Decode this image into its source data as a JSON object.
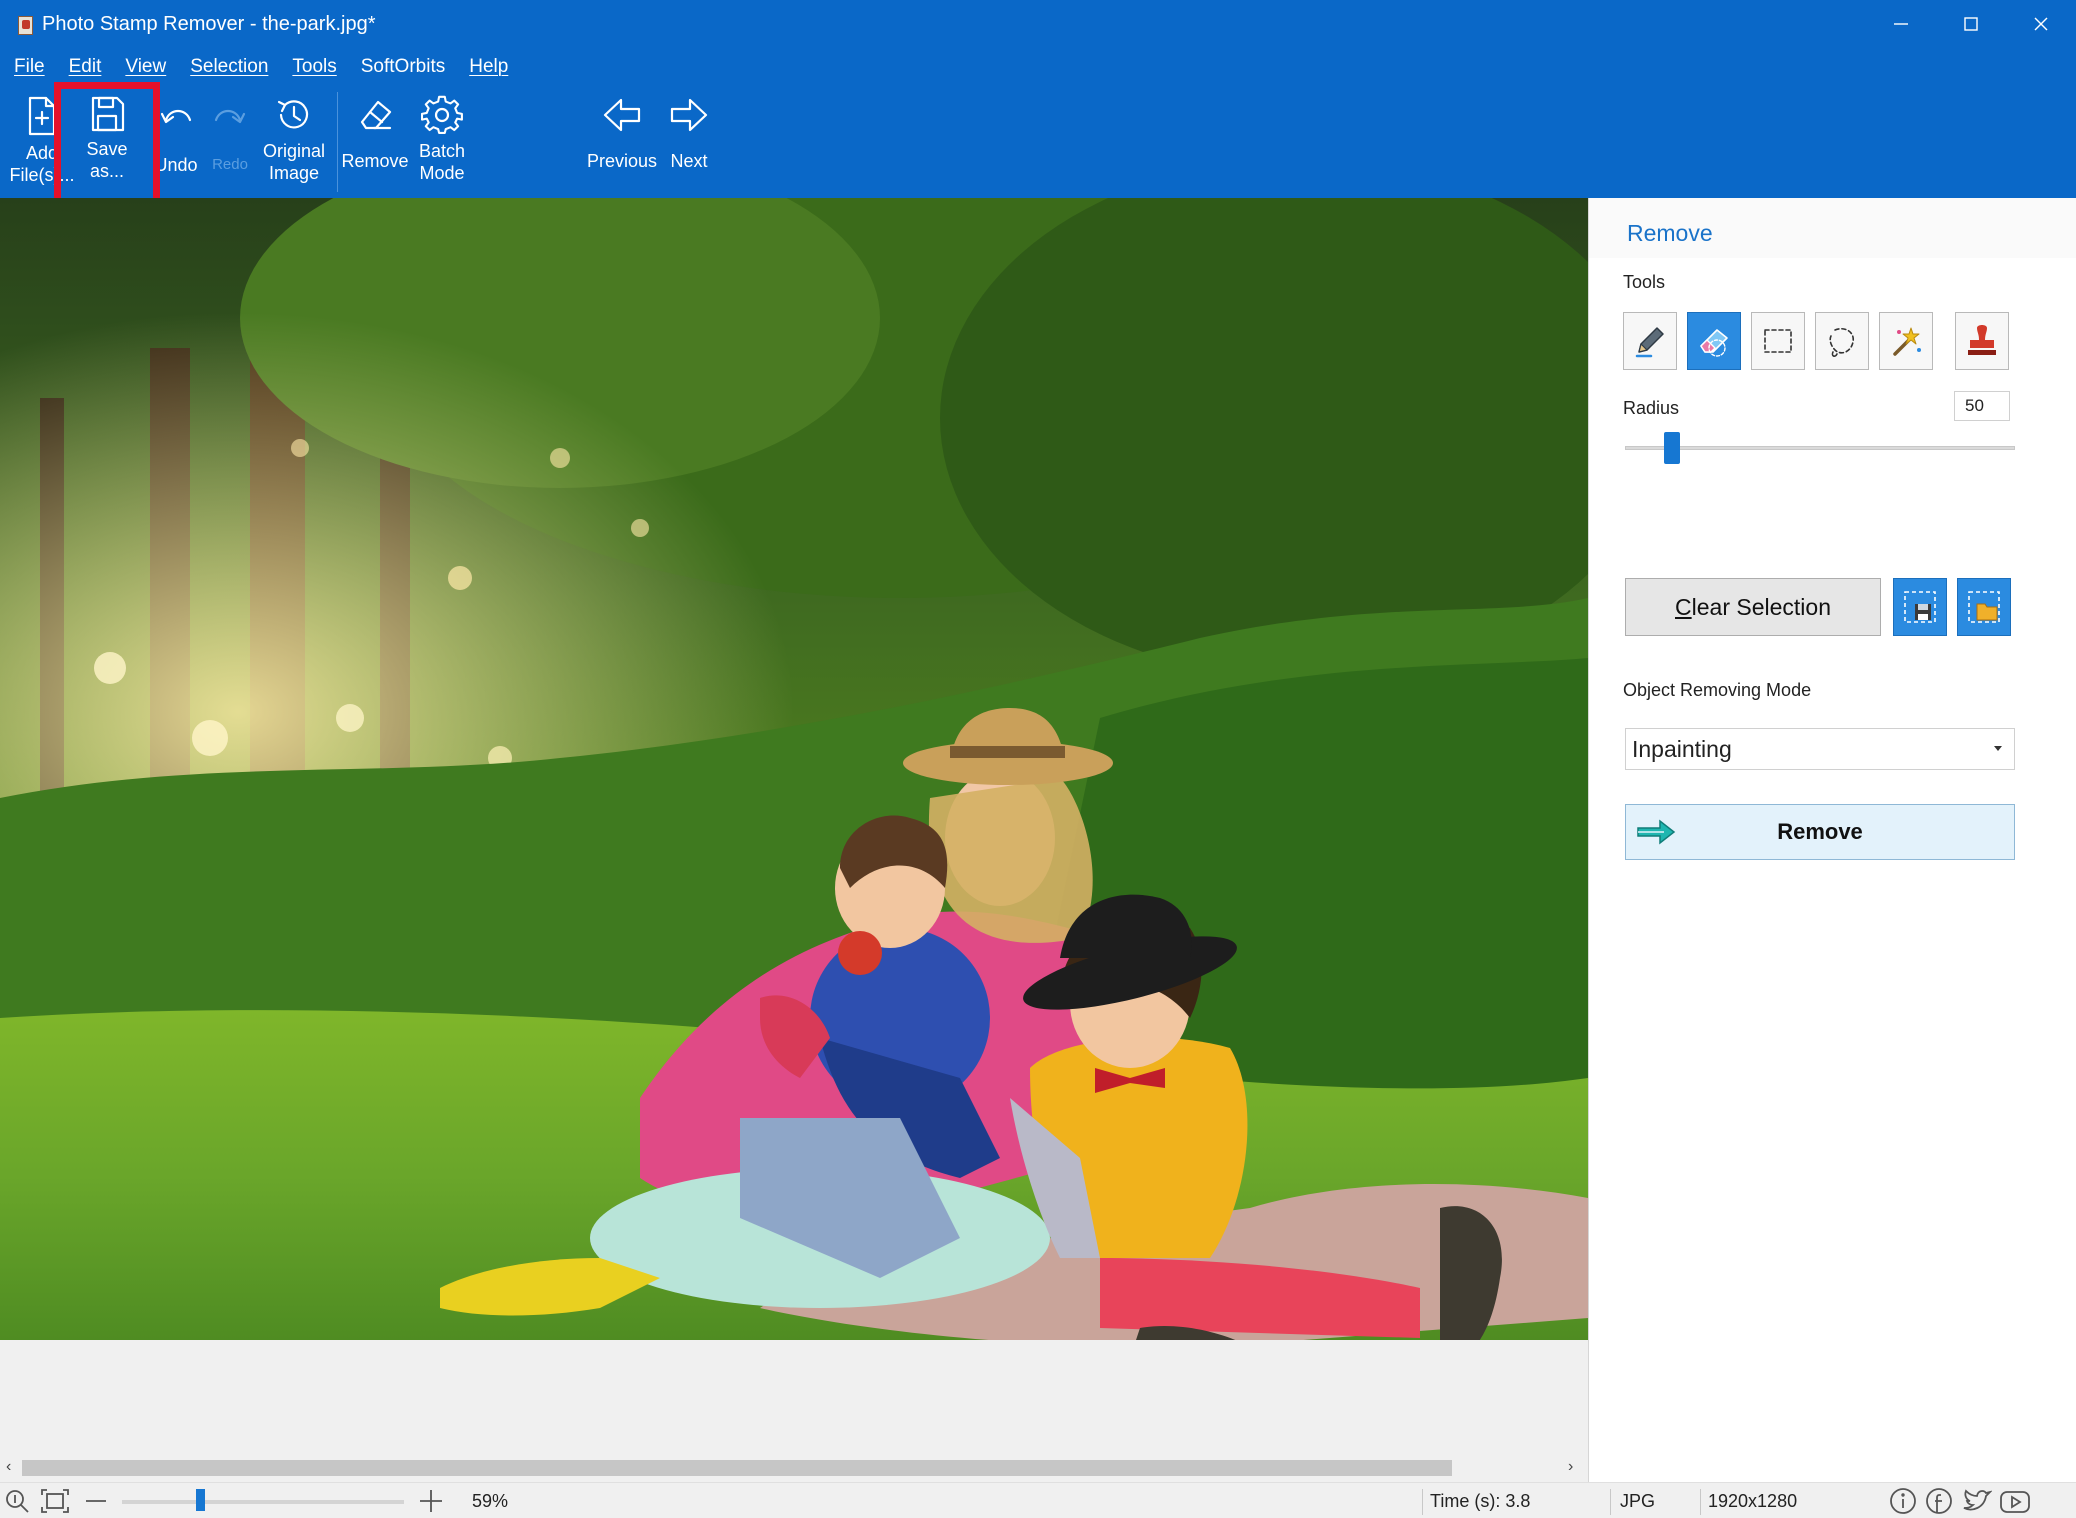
{
  "window": {
    "title": "Photo Stamp Remover - the-park.jpg*"
  },
  "menu": [
    "File",
    "Edit",
    "View",
    "Selection",
    "Tools",
    "SoftOrbits",
    "Help"
  ],
  "toolbar": {
    "add_files": "Add\nFile(s)...",
    "save_as": "Save\nas...",
    "undo": "Undo",
    "redo": "Redo",
    "original_image": "Original\nImage",
    "remove": "Remove",
    "batch_mode": "Batch\nMode",
    "previous": "Previous",
    "next": "Next"
  },
  "panel": {
    "title": "Remove",
    "tools_label": "Tools",
    "radius_label": "Radius",
    "radius_value": "50",
    "radius_level": 0.1,
    "clear_selection_first": "C",
    "clear_selection_rest": "lear Selection",
    "mode_label": "Object Removing Mode",
    "mode_value": "Inpainting",
    "remove_button": "Remove"
  },
  "status": {
    "zoom": "59%",
    "time": "Time (s): 3.8",
    "format": "JPG",
    "dimensions": "1920x1280"
  },
  "colors": {
    "brand_blue": "#0a68c8",
    "accent": "#2b8be0",
    "highlight_red": "#e5112a"
  }
}
